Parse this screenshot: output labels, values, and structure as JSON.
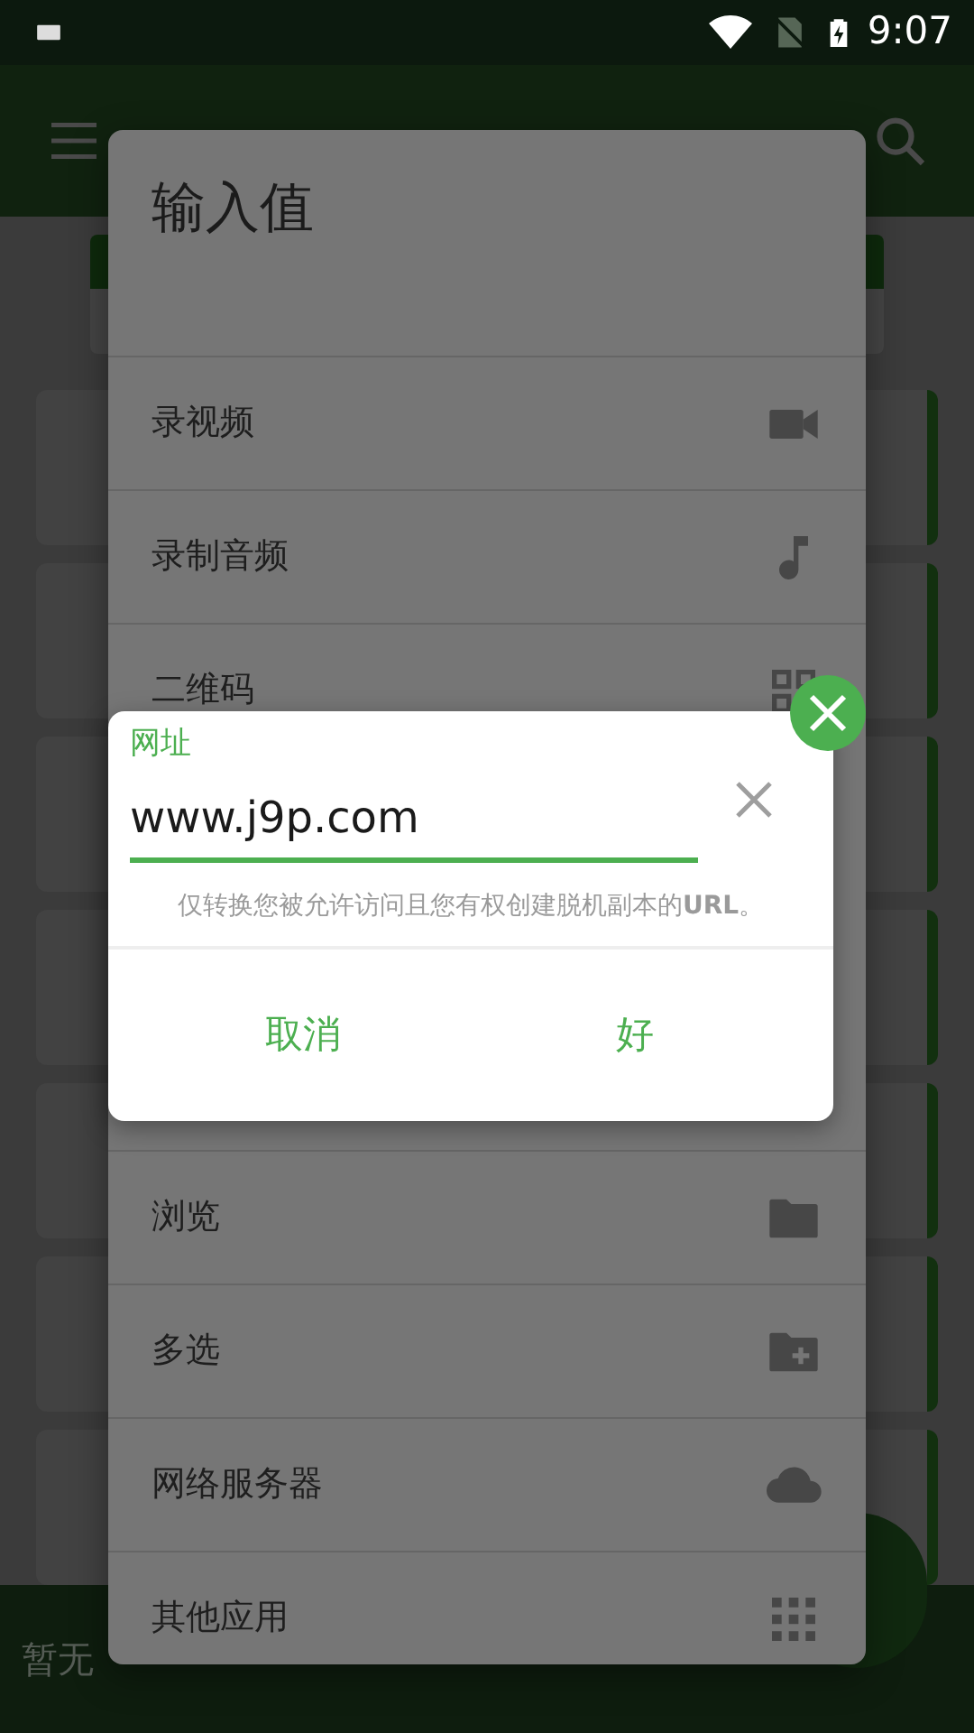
{
  "status_bar": {
    "time": "9:07"
  },
  "footer": {
    "empty_label": "暂无"
  },
  "input_dialog": {
    "title": "输入值",
    "items": [
      {
        "label": "录视频",
        "kind": "video"
      },
      {
        "label": "录制音频",
        "kind": "audio"
      },
      {
        "label": "二维码",
        "kind": "qr"
      }
    ],
    "bottom_items": [
      {
        "label": "浏览",
        "kind": "browse"
      },
      {
        "label": "多选",
        "kind": "multi"
      },
      {
        "label": "网络服务器",
        "kind": "server"
      },
      {
        "label": "其他应用",
        "kind": "apps"
      }
    ]
  },
  "url_dialog": {
    "label": "网址",
    "value": "www.j9p.com",
    "hint": "仅转换您被允许访问且您有权创建脱机副本的**URL**。",
    "buttons": [
      "取消",
      "好"
    ]
  }
}
